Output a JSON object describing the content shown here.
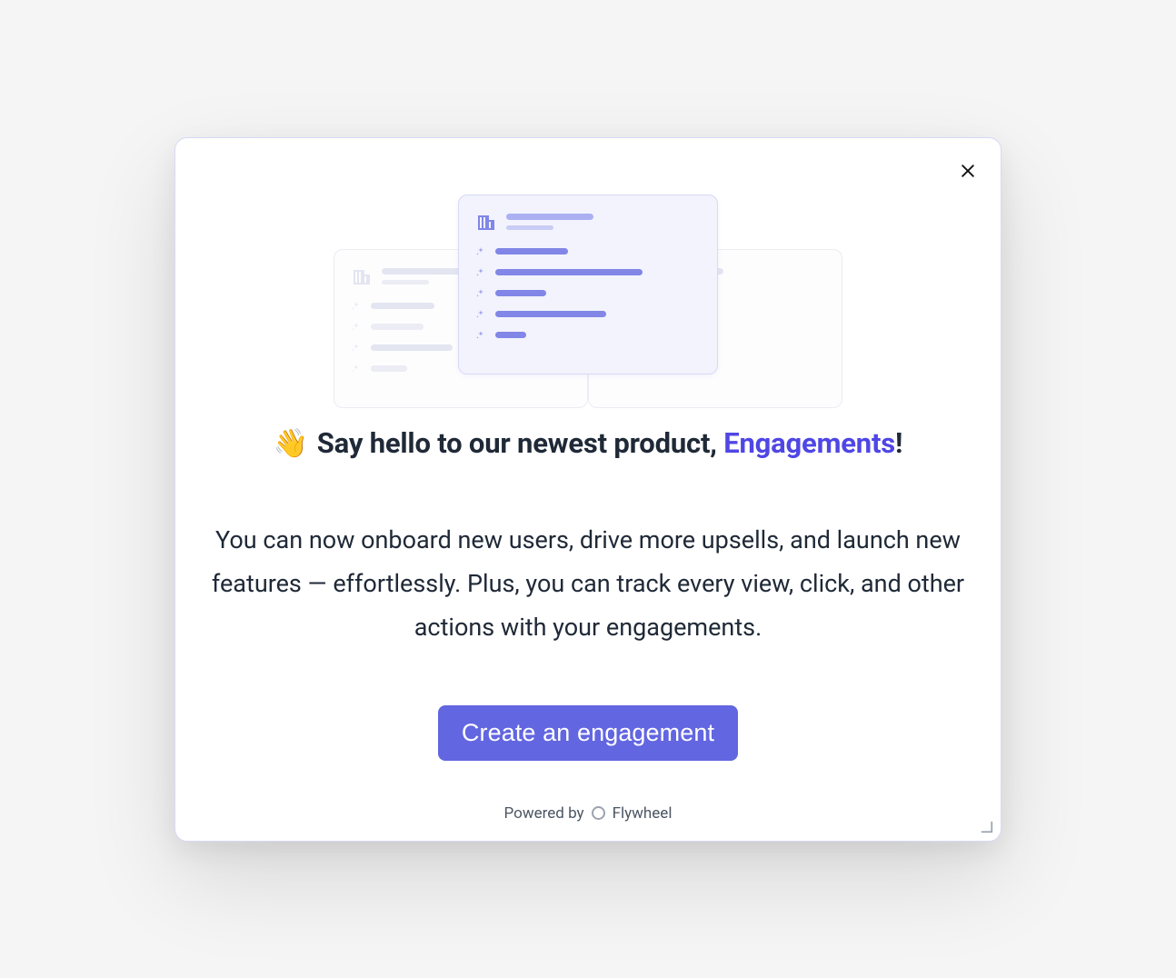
{
  "heading": {
    "emoji": "👋",
    "prefix": "Say hello to our newest product, ",
    "highlight": "Engagements",
    "suffix": "!"
  },
  "body": "You can now onboard new users, drive more upsells, and launch new features — effortlessly. Plus, you can track every view, click, and  other actions with your engagements.",
  "cta_label": "Create an engagement",
  "footer": {
    "powered_by": "Powered by",
    "brand": "Flywheel"
  }
}
